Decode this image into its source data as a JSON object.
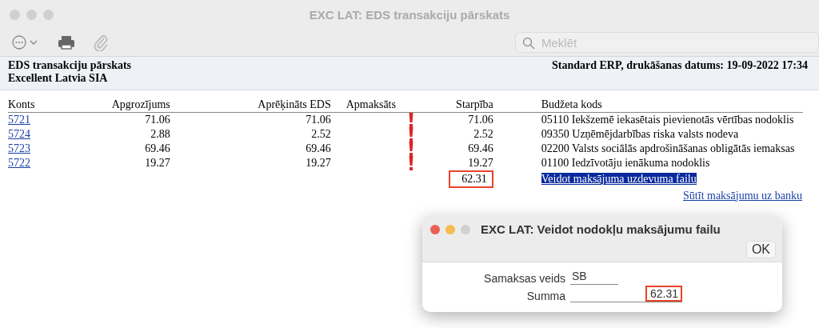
{
  "window": {
    "title": "EXC LAT: EDS transakciju pārskats"
  },
  "search": {
    "placeholder": "Meklēt"
  },
  "report": {
    "title": "EDS transakciju pārskats",
    "company": "Excellent Latvia SIA",
    "printed": "Standard ERP, drukāšanas datums: 19-09-2022 17:34"
  },
  "table": {
    "columns": [
      "Konts",
      "Apgrozījums",
      "Aprēķināts EDS",
      "Apmaksāts",
      "Starpība",
      "Budžeta kods"
    ],
    "rows": [
      {
        "account": "5721",
        "turnover": "71.06",
        "calculated": "71.06",
        "warning": true,
        "difference": "71.06",
        "budget_code": "05110 Iekšzemē iekasētais pievienotās vērtības nodoklis"
      },
      {
        "account": "5724",
        "turnover": "2.88",
        "calculated": "2.52",
        "warning": true,
        "difference": "2.52",
        "budget_code": "09350 Uzņēmējdarbības riska valsts nodeva"
      },
      {
        "account": "5723",
        "turnover": "69.46",
        "calculated": "69.46",
        "warning": true,
        "difference": "69.46",
        "budget_code": "02200 Valsts sociālās apdrošināšanas obligātās iemaksas"
      },
      {
        "account": "5722",
        "turnover": "19.27",
        "calculated": "19.27",
        "warning": true,
        "difference": "19.27",
        "budget_code": "01100 Iedzīvotāju ienākuma nodoklis"
      }
    ],
    "total": {
      "value": "62.31",
      "highlighted": true
    }
  },
  "links": [
    {
      "label": "Veidot maksājuma uzdevuma failu",
      "selected": true
    },
    {
      "label": "Sūtīt maksājumu uz banku",
      "selected": false
    }
  ],
  "dialog": {
    "title": "EXC LAT: Veidot nodokļu maksājumu failu",
    "button": "OK",
    "fields": [
      {
        "label": "Samaksas veids",
        "value": "SB",
        "highlighted": false
      },
      {
        "label": "Summa",
        "value": "62.31",
        "highlighted": true
      }
    ]
  }
}
